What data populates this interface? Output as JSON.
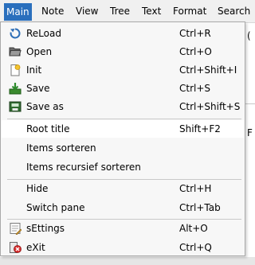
{
  "menubar": {
    "items": [
      {
        "label": "Main"
      },
      {
        "label": "Note"
      },
      {
        "label": "View"
      },
      {
        "label": "Tree"
      },
      {
        "label": "Text"
      },
      {
        "label": "Format"
      },
      {
        "label": "Search"
      }
    ]
  },
  "background": {
    "fragments": [
      "(",
      "F"
    ]
  },
  "main_menu": {
    "items": [
      {
        "label": "ReLoad",
        "shortcut": "Ctrl+R",
        "icon": "reload-icon"
      },
      {
        "label": "Open",
        "shortcut": "Ctrl+O",
        "icon": "folder-open-icon"
      },
      {
        "label": "Init",
        "shortcut": "Ctrl+Shift+I",
        "icon": "new-document-icon"
      },
      {
        "label": "Save",
        "shortcut": "Ctrl+S",
        "icon": "save-icon"
      },
      {
        "label": "Save as",
        "shortcut": "Ctrl+Shift+S",
        "icon": "save-as-icon"
      },
      {
        "label": "Root title",
        "shortcut": "Shift+F2"
      },
      {
        "label": "Items sorteren",
        "shortcut": ""
      },
      {
        "label": "Items recursief sorteren",
        "shortcut": ""
      },
      {
        "label": "Hide",
        "shortcut": "Ctrl+H"
      },
      {
        "label": "Switch pane",
        "shortcut": "Ctrl+Tab"
      },
      {
        "label": "sEttings",
        "shortcut": "Alt+O",
        "icon": "settings-icon"
      },
      {
        "label": "eXit",
        "shortcut": "Ctrl+Q",
        "icon": "exit-icon"
      }
    ]
  }
}
